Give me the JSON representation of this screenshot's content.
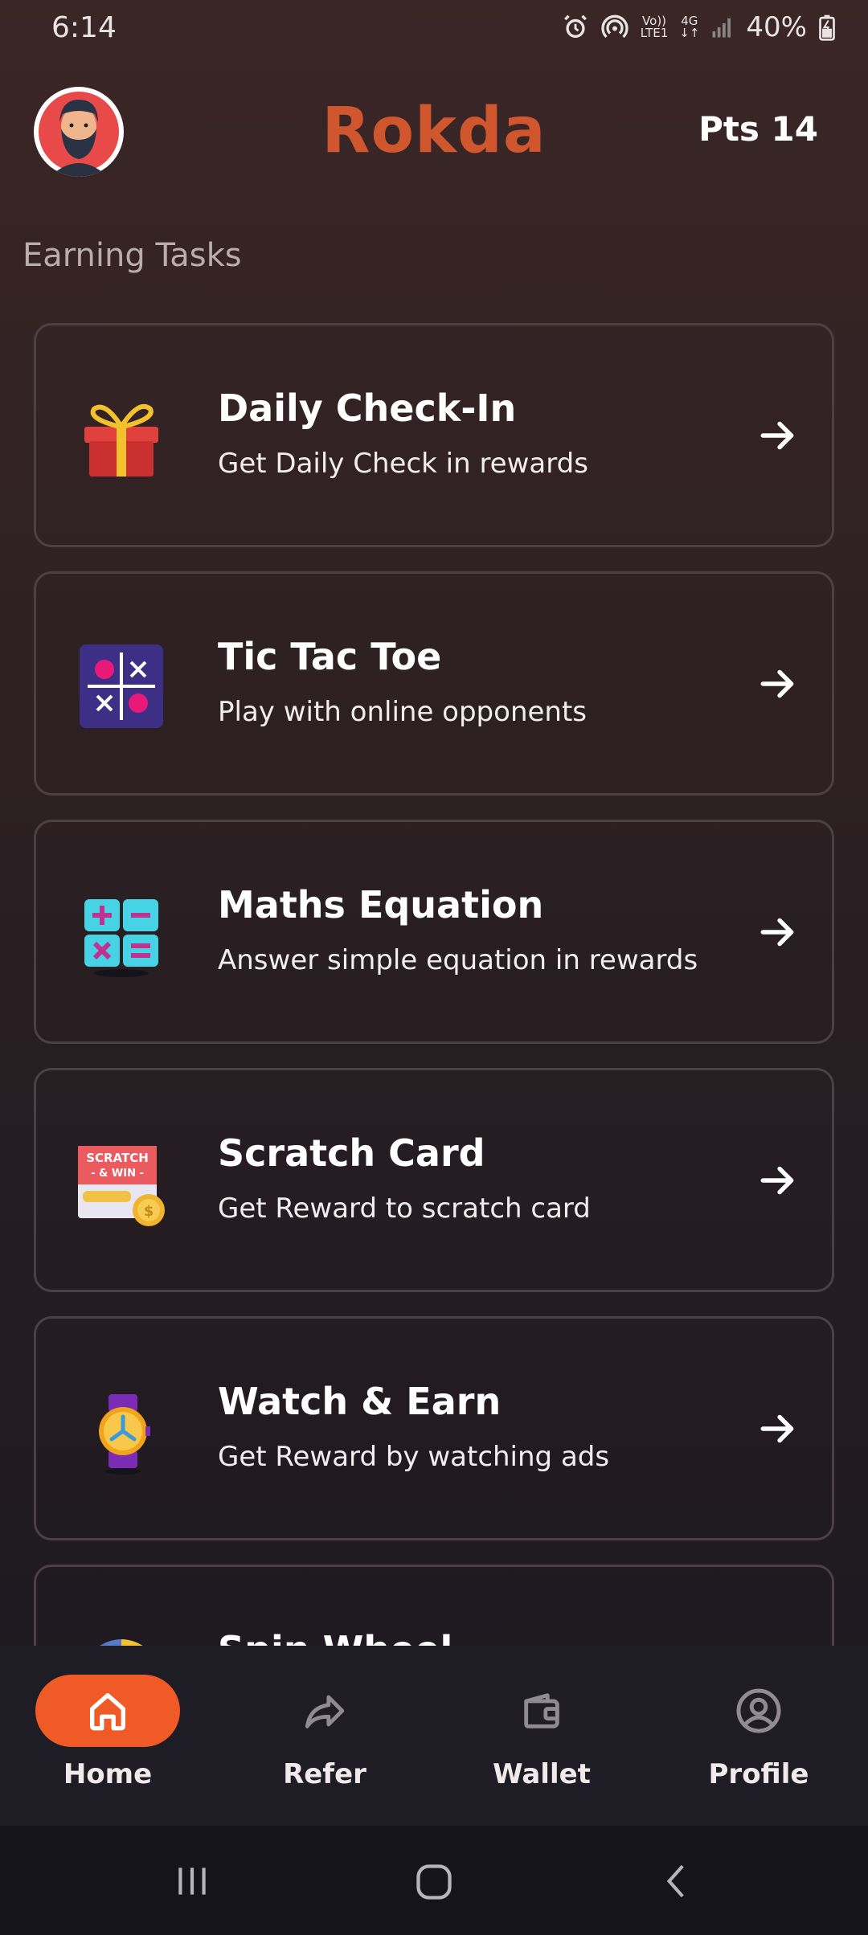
{
  "status_bar": {
    "time": "6:14",
    "network_top": "Vo))",
    "network_bottom": "LTE1",
    "net_type": "4G",
    "battery": "40%"
  },
  "header": {
    "brand": "Rokda",
    "points": "Pts 14"
  },
  "section_title": "Earning Tasks",
  "tasks": [
    {
      "title": "Daily Check-In",
      "subtitle": "Get Daily Check in rewards",
      "icon": "gift-icon"
    },
    {
      "title": "Tic Tac Toe",
      "subtitle": "Play with online opponents",
      "icon": "tic-tac-toe-icon"
    },
    {
      "title": "Maths Equation",
      "subtitle": "Answer simple equation in rewards",
      "icon": "calculator-icon"
    },
    {
      "title": "Scratch Card",
      "subtitle": "Get Reward to scratch card",
      "icon": "scratch-card-icon"
    },
    {
      "title": "Watch & Earn",
      "subtitle": "Get Reward by watching ads",
      "icon": "watch-icon"
    },
    {
      "title": "Spin Wheel",
      "subtitle": "",
      "icon": "spin-wheel-icon"
    }
  ],
  "scratch_icon_text": {
    "line1": "SCRATCH",
    "line2": "- & WIN -"
  },
  "nav": {
    "home": "Home",
    "refer": "Refer",
    "wallet": "Wallet",
    "profile": "Profile"
  },
  "colors": {
    "accent": "#f05a26",
    "brand": "#d0562e",
    "card_border": "#4b4143"
  }
}
